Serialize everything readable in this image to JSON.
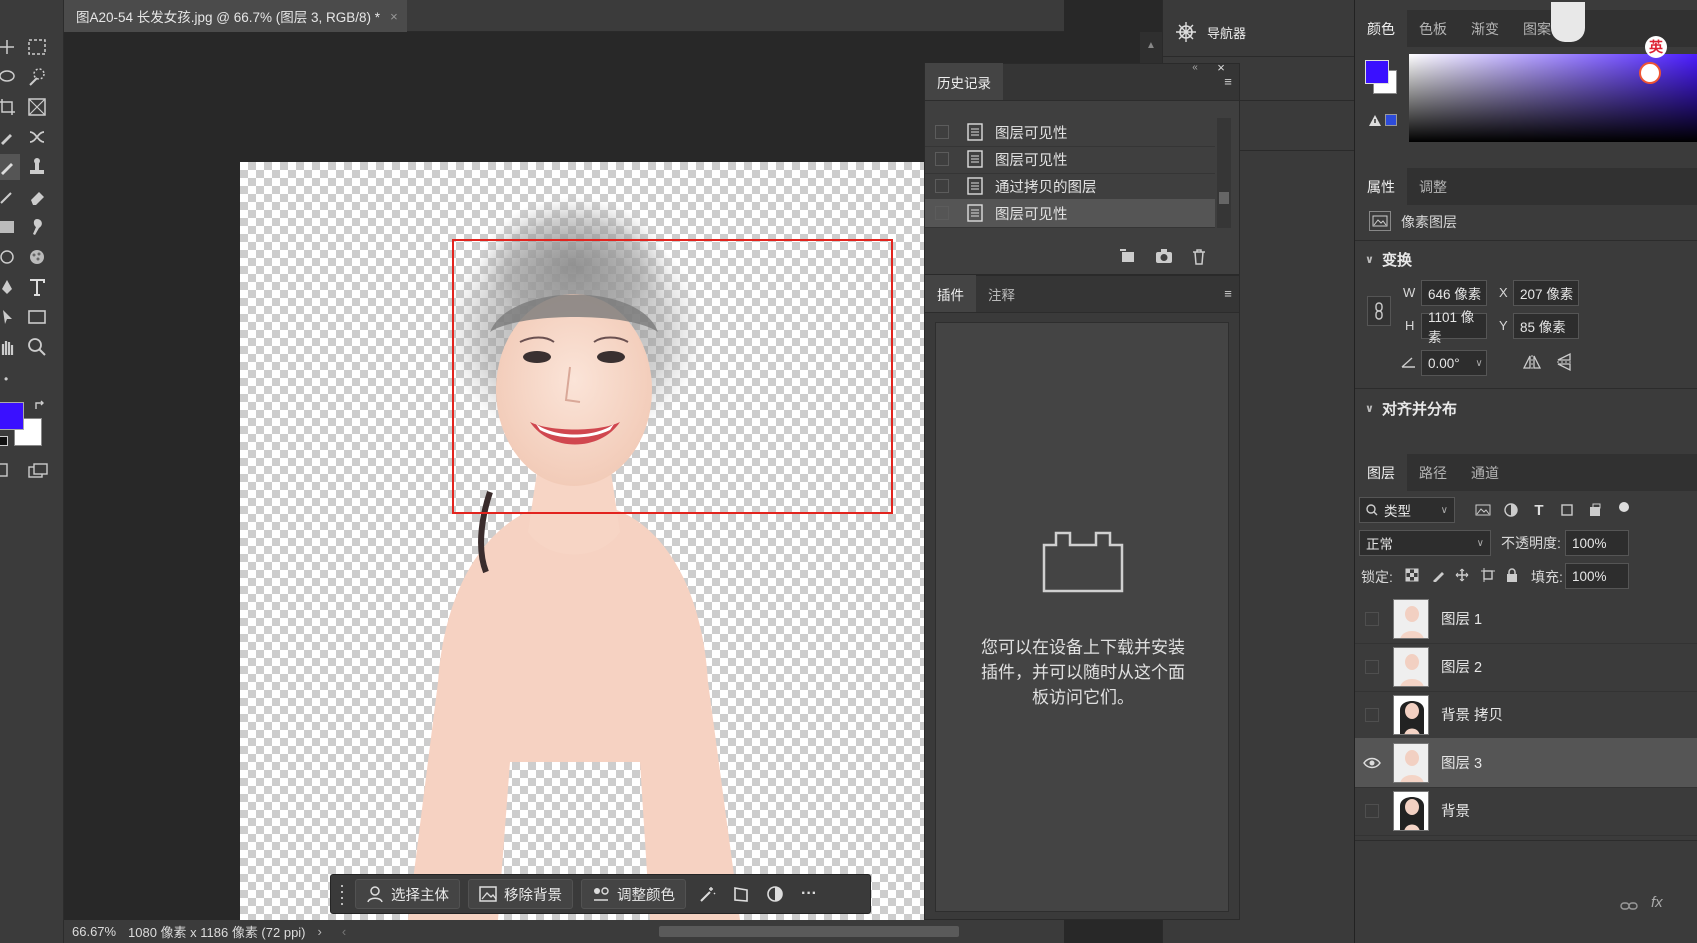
{
  "document": {
    "tab_title": "图A20-54 长发女孩.jpg @ 66.7% (图层 3, RGB/8) *",
    "close_glyph": "×"
  },
  "status": {
    "zoom": "66.67%",
    "doc_info": "1080 像素 x 1186 像素 (72 ppi)",
    "arrow": "›"
  },
  "taskbar": {
    "select_subject": "选择主体",
    "remove_bg": "移除背景",
    "adjust_color": "调整颜色",
    "more": "···"
  },
  "navigator": {
    "title": "导航器"
  },
  "history": {
    "title": "历史记录",
    "items": [
      {
        "label": "图层可见性"
      },
      {
        "label": "图层可见性"
      },
      {
        "label": "通过拷贝的图层"
      },
      {
        "label": "图层可见性"
      }
    ]
  },
  "plugins": {
    "tab_plugins": "插件",
    "tab_notes": "注释",
    "message_line1": "您可以在设备上下载并安装",
    "message_line2": "插件，并可以随时从这个面",
    "message_line3": "板访问它们。"
  },
  "color_panel": {
    "tabs": [
      "颜色",
      "色板",
      "渐变",
      "图案"
    ],
    "foreground": "#3a10ff",
    "background": "#ffffff"
  },
  "properties": {
    "tabs": [
      "属性",
      "调整"
    ],
    "layer_type": "像素图层",
    "transform_title": "变换",
    "w_label": "W",
    "w_value": "646 像素",
    "x_label": "X",
    "x_value": "207 像素",
    "h_label": "H",
    "h_value": "1101 像素",
    "y_label": "Y",
    "y_value": "85 像素",
    "angle_value": "0.00°",
    "align_title": "对齐并分布"
  },
  "layers_panel": {
    "tabs": [
      "图层",
      "路径",
      "通道"
    ],
    "filter_kind": "类型",
    "blend_mode": "正常",
    "opacity_label": "不透明度:",
    "opacity_value": "100%",
    "lock_label": "锁定:",
    "fill_label": "填充:",
    "fill_value": "100%",
    "layers": [
      {
        "name": "图层 1",
        "visible": false,
        "selected": false
      },
      {
        "name": "图层 2",
        "visible": false,
        "selected": false
      },
      {
        "name": "背景 拷贝",
        "visible": false,
        "selected": false
      },
      {
        "name": "图层 3",
        "visible": true,
        "selected": true
      },
      {
        "name": "背景",
        "visible": false,
        "selected": false
      }
    ],
    "footer_fx": "fx"
  },
  "ime": {
    "label": "英"
  }
}
